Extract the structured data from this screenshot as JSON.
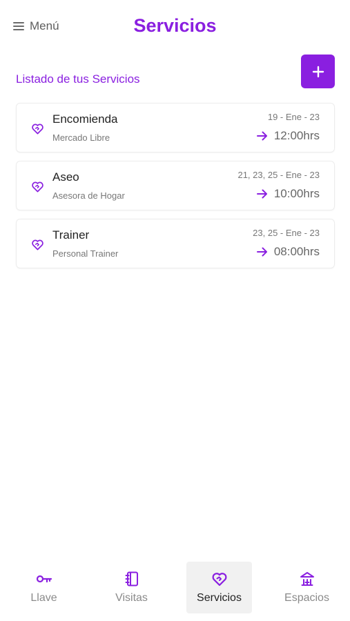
{
  "header": {
    "menu_label": "Menú",
    "title": "Servicios"
  },
  "section": {
    "title": "Listado de tus Servicios",
    "add_label": "+"
  },
  "services": [
    {
      "name": "Encomienda",
      "provider": "Mercado Libre",
      "dates": "19 - Ene - 23",
      "time": "12:00hrs"
    },
    {
      "name": "Aseo",
      "provider": "Asesora de Hogar",
      "dates": "21, 23, 25 - Ene - 23",
      "time": "10:00hrs"
    },
    {
      "name": "Trainer",
      "provider": "Personal Trainer",
      "dates": "23, 25 - Ene - 23",
      "time": "08:00hrs"
    }
  ],
  "bottom_nav": [
    {
      "label": "Llave",
      "icon": "key-icon"
    },
    {
      "label": "Visitas",
      "icon": "notebook-icon"
    },
    {
      "label": "Servicios",
      "icon": "heart-hand-icon",
      "active": true
    },
    {
      "label": "Espacios",
      "icon": "building-icon"
    }
  ],
  "colors": {
    "accent": "#8a1fe0",
    "nav_active_bg": "#f1f1f1"
  }
}
